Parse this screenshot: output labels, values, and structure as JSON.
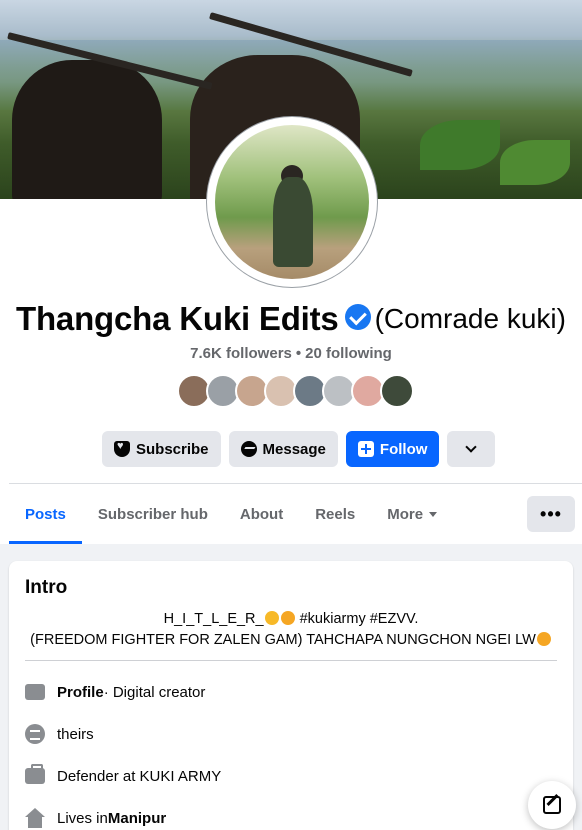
{
  "profile": {
    "name": "Thangcha Kuki Edits",
    "alt_name": "(Comrade kuki)",
    "followers": "7.6K followers",
    "separator": "•",
    "following": "20 following",
    "verified_icon": "verified-badge-icon"
  },
  "friend_avatar_colors": [
    "#8a6d5a",
    "#9aa0a6",
    "#c7a58e",
    "#d9c1b0",
    "#6c7a86",
    "#bcc0c4",
    "#e0a9a0",
    "#3e4a3a"
  ],
  "actions": {
    "subscribe": "Subscribe",
    "message": "Message",
    "follow": "Follow"
  },
  "tabs": {
    "posts": "Posts",
    "subscriber_hub": "Subscriber hub",
    "about": "About",
    "reels": "Reels",
    "more": "More",
    "menu": "•••"
  },
  "intro": {
    "title": "Intro",
    "bio_line1_a": "H_I_T_L_E_R_",
    "bio_line1_b": " #kukiarmy #EZVV.",
    "bio_line2": "(FREEDOM FIGHTER FOR ZALEN GAM) TAHCHAPA NUNGCHON NGEI LW",
    "profile_label": "Profile",
    "profile_value": " · Digital creator",
    "pronoun": "theirs",
    "work": "Defender at KUKI ARMY",
    "lives_prefix": "Lives in ",
    "lives_value": "Manipur"
  },
  "colors": {
    "accent": "#0866ff",
    "verified": "#1877f2",
    "secondary_text": "#65676b"
  }
}
